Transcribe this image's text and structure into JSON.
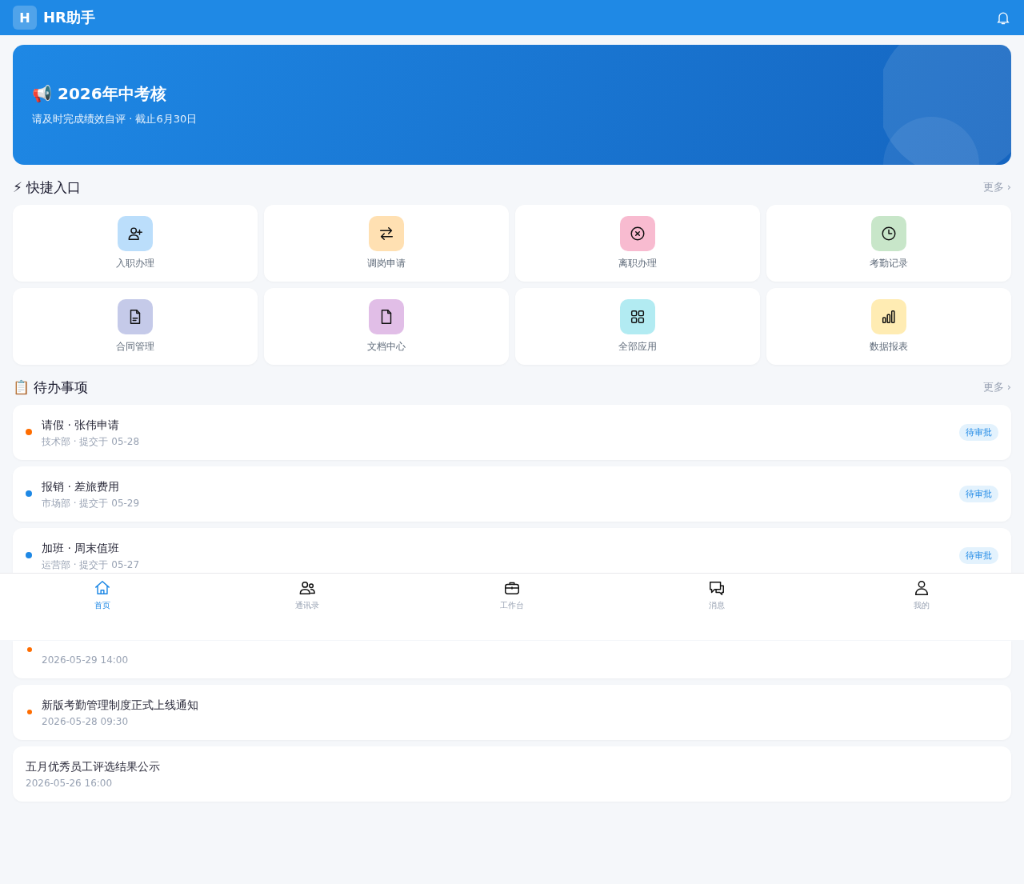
{
  "header": {
    "logo": "H",
    "title": "HR助手"
  },
  "banner": {
    "title": "📢 2026年中考核",
    "subtitle": "请及时完成绩效自评 · 截止6月30日"
  },
  "quick_section": {
    "title": "⚡ 快捷入口",
    "more": "更多 ›"
  },
  "quick_entries": [
    {
      "label": "入职办理",
      "kind": "onboard",
      "color": "#bbdefb"
    },
    {
      "label": "调岗申请",
      "kind": "transfer",
      "color": "#ffe0b2"
    },
    {
      "label": "离职办理",
      "kind": "resign",
      "color": "#f8bbd0"
    },
    {
      "label": "考勤记录",
      "kind": "attendance",
      "color": "#c8e6c9"
    },
    {
      "label": "合同管理",
      "kind": "contract",
      "color": "#c5cae9"
    },
    {
      "label": "文档中心",
      "kind": "documents",
      "color": "#e1bee7"
    },
    {
      "label": "全部应用",
      "kind": "apps",
      "color": "#b2ebf2"
    },
    {
      "label": "数据报表",
      "kind": "reports",
      "color": "#ffecb3"
    }
  ],
  "todo_section": {
    "title": "📋 待办事项",
    "more": "更多 ›"
  },
  "todos": [
    {
      "title": "请假 · 张伟申请",
      "meta": "技术部 · 提交于 05-28",
      "badge": "待审批",
      "color": "#ff6d00"
    },
    {
      "title": "报销 · 差旅费用",
      "meta": "市场部 · 提交于 05-29",
      "badge": "待审批",
      "color": "#1e88e5"
    },
    {
      "title": "加班 · 周末值班",
      "meta": "运营部 · 提交于 05-27",
      "badge": "待审批",
      "color": "#1e88e5"
    }
  ],
  "notices": [
    {
      "time": "2026-05-29 14:00",
      "unread": true
    },
    {
      "title": "新版考勤管理制度正式上线通知",
      "time": "2026-05-28 09:30",
      "unread": true
    },
    {
      "title": "五月优秀员工评选结果公示",
      "time": "2026-05-26 16:00",
      "unread": false
    }
  ],
  "bottom_nav": [
    {
      "label": "首页",
      "kind": "home",
      "selected": true
    },
    {
      "label": "通讯录",
      "kind": "contacts",
      "selected": false
    },
    {
      "label": "工作台",
      "kind": "workbench",
      "selected": false
    },
    {
      "label": "消息",
      "kind": "messages",
      "selected": false
    },
    {
      "label": "我的",
      "kind": "profile",
      "selected": false
    }
  ]
}
